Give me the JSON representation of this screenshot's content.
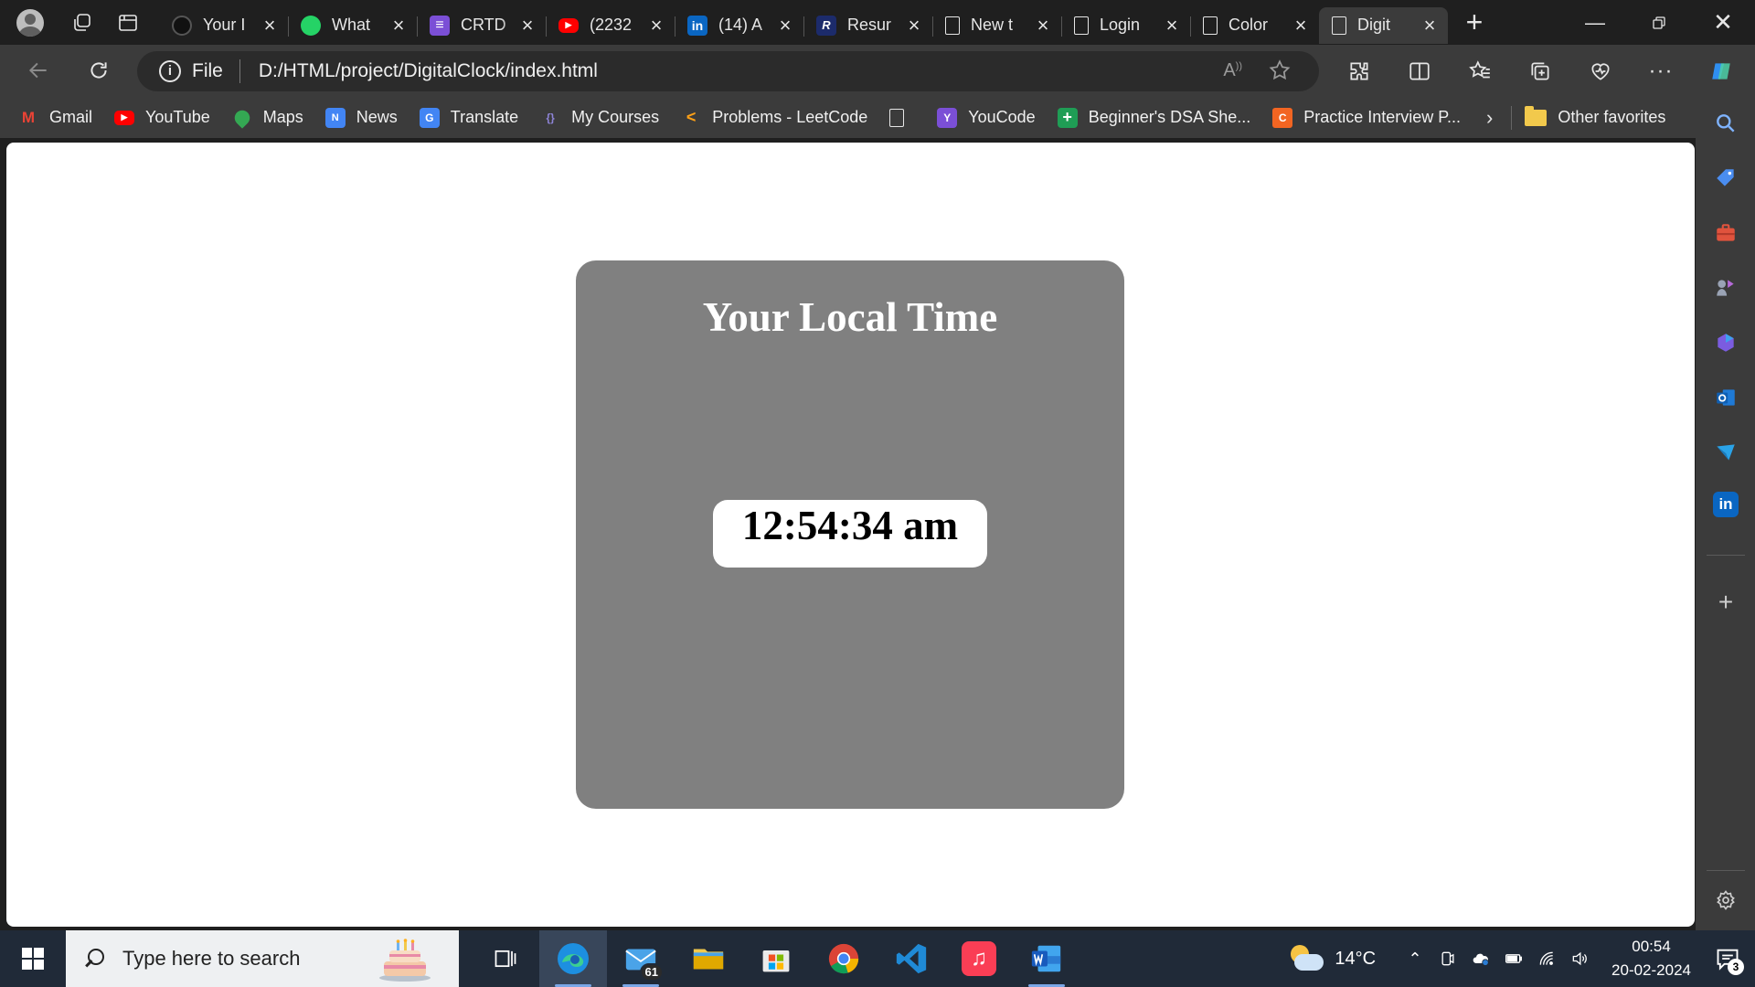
{
  "browser": {
    "tabs": [
      {
        "title": "Your I",
        "icon": "github-icon",
        "color": "#1f1f1f"
      },
      {
        "title": "What",
        "icon": "whatsapp-icon",
        "color": "#25d366"
      },
      {
        "title": "CRTD",
        "icon": "list-icon",
        "color": "#7b4fd6"
      },
      {
        "title": "(2232",
        "icon": "youtube-icon",
        "color": "#ff0000"
      },
      {
        "title": "(14) A",
        "icon": "linkedin-icon",
        "color": "#0a66c2"
      },
      {
        "title": "Resur",
        "icon": "resume-r-icon",
        "color": "#1c2b6b"
      },
      {
        "title": "New t",
        "icon": "newtab-icon",
        "color": "#3b3b3b"
      },
      {
        "title": "Login",
        "icon": "page-icon",
        "color": "#3b3b3b"
      },
      {
        "title": "Color",
        "icon": "page-icon",
        "color": "#3b3b3b"
      },
      {
        "title": "Digit",
        "icon": "page-icon",
        "color": "#3b3b3b",
        "active": true
      }
    ],
    "address": {
      "scheme_label": "File",
      "url": "D:/HTML/project/DigitalClock/index.html"
    },
    "favorites": [
      {
        "label": "Gmail",
        "icon": "gmail-icon",
        "color": "#ea4335"
      },
      {
        "label": "YouTube",
        "icon": "youtube-icon",
        "color": "#ff0000"
      },
      {
        "label": "Maps",
        "icon": "maps-icon",
        "color": "#34a853"
      },
      {
        "label": "News",
        "icon": "news-icon",
        "color": "#4285f4"
      },
      {
        "label": "Translate",
        "icon": "translate-icon",
        "color": "#4285f4"
      },
      {
        "label": "My Courses",
        "icon": "courses-icon",
        "color": "#6b5fb5"
      },
      {
        "label": "Problems - LeetCode",
        "icon": "leetcode-icon",
        "color": "#ffa116"
      },
      {
        "label": "",
        "icon": "page-icon",
        "color": "#3b3b3b"
      },
      {
        "label": "YouCode",
        "icon": "youcode-icon",
        "color": "#7b4fd6"
      },
      {
        "label": "Beginner's DSA She...",
        "icon": "plus-green-icon",
        "color": "#1f9d55"
      },
      {
        "label": "Practice Interview P...",
        "icon": "interview-icon",
        "color": "#f26522"
      }
    ],
    "other_favorites": "Other favorites"
  },
  "page": {
    "heading": "Your Local Time",
    "time": "12:54:34 am"
  },
  "taskbar": {
    "search_placeholder": "Type here to search",
    "mail_badge": "61",
    "weather_temp": "14°C",
    "time": "00:54",
    "date": "20-02-2024",
    "notification_count": "3"
  }
}
